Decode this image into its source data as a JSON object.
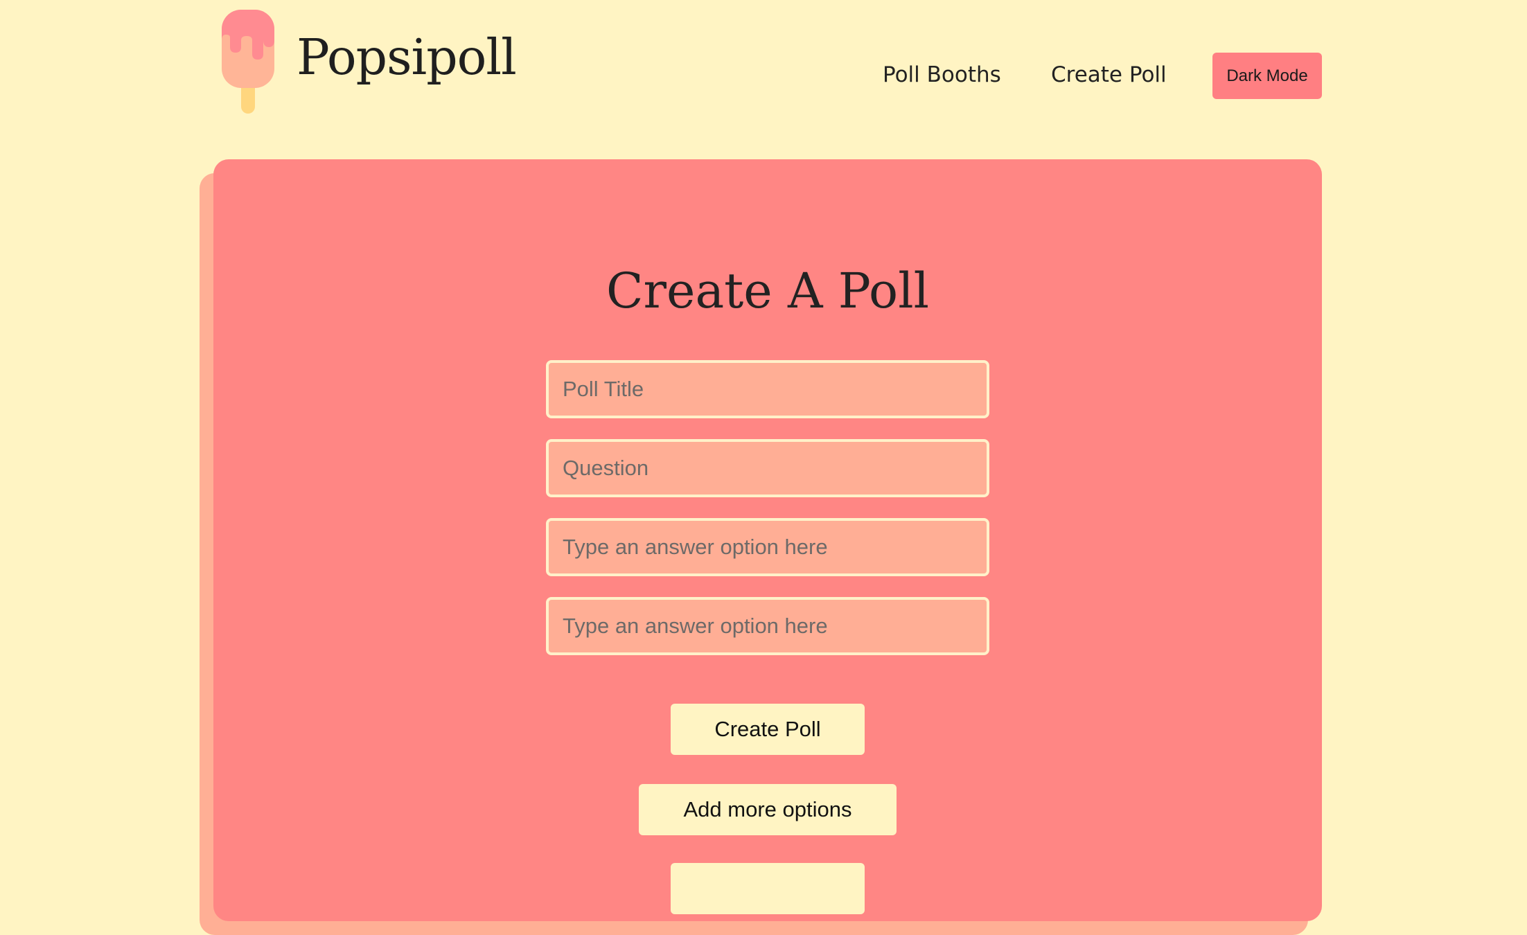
{
  "header": {
    "brand": "Popsipoll",
    "nav": [
      {
        "label": "Poll Booths"
      },
      {
        "label": "Create Poll"
      }
    ],
    "dark_mode_label": "Dark Mode"
  },
  "form": {
    "title": "Create A Poll",
    "fields": [
      {
        "placeholder": "Poll Title",
        "value": ""
      },
      {
        "placeholder": "Question",
        "value": ""
      },
      {
        "placeholder": "Type an answer option here",
        "value": ""
      },
      {
        "placeholder": "Type an answer option here",
        "value": ""
      }
    ],
    "create_label": "Create Poll",
    "add_options_label": "Add more options"
  },
  "icons": {
    "logo": "popsicle-icon"
  },
  "colors": {
    "background": "#fff4c3",
    "card": "#ff8684",
    "card_shadow": "#ffaf95",
    "field_fill": "#ffae95",
    "field_border": "#fff1c9",
    "button_fill": "#fff4c3",
    "dark_mode_button": "#ff7f82",
    "popsicle_body": "#ffb597",
    "popsicle_drip": "#ff8b91",
    "popsicle_stick": "#ffd67e"
  }
}
